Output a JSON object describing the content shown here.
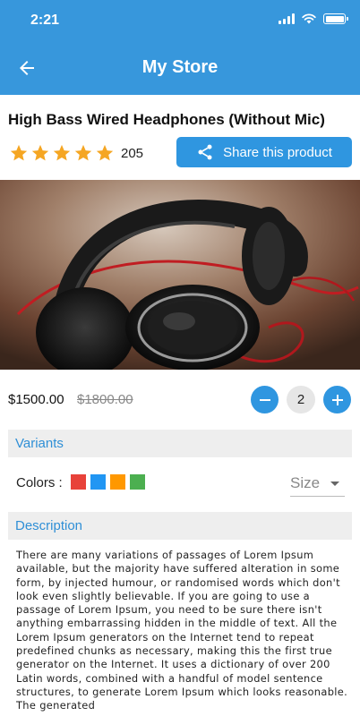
{
  "status_bar": {
    "time": "2:21"
  },
  "app_bar": {
    "title": "My Store",
    "back_icon": "arrow-left-icon"
  },
  "product": {
    "title": "High Bass Wired Headphones (Without Mic)",
    "rating_stars": 5,
    "rating_count": "205",
    "share_label": "Share this product",
    "price": "$1500.00",
    "old_price": "$1800.00",
    "quantity": "2"
  },
  "variants": {
    "header": "Variants",
    "colors_label": "Colors :",
    "colors": [
      "#e8423a",
      "#2196f3",
      "#ff9800",
      "#4caf50"
    ],
    "size_label": "Size"
  },
  "description": {
    "header": "Description",
    "text": "There are many variations of passages of Lorem Ipsum available, but the majority have suffered alteration in some form, by injected humour, or randomised words which don't look even slightly believable. If you are going to use a passage of Lorem Ipsum, you need to be sure there isn't anything embarrassing hidden in the middle of text. All the Lorem Ipsum generators on the Internet tend to repeat predefined chunks as necessary, making this the first true generator on the Internet. It uses a dictionary of over 200 Latin words, combined with a handful of model sentence structures, to generate Lorem Ipsum which looks reasonable. The generated"
  },
  "colors": {
    "primary": "#3797dc",
    "star": "#f5a623"
  }
}
